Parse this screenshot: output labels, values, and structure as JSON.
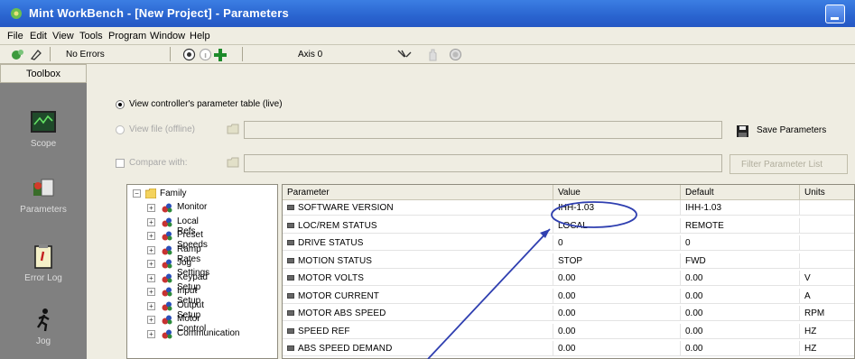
{
  "window": {
    "title": "Mint WorkBench - [New Project] - Parameters"
  },
  "menu": [
    "File",
    "Edit",
    "View",
    "Tools",
    "Program",
    "Window",
    "Help"
  ],
  "toolbar": {
    "status": "No Errors",
    "axis": "Axis 0"
  },
  "toolbox": {
    "header": "Toolbox",
    "items": [
      "Scope",
      "Parameters",
      "Error Log",
      "Jog"
    ]
  },
  "options": {
    "view_live": "View controller's parameter table (live)",
    "view_file": "View file (offline)",
    "compare_with": "Compare with:",
    "save_button": "Save Parameters",
    "filter_button": "Filter Parameter List"
  },
  "tree": {
    "root": "Family",
    "items": [
      "Monitor",
      "Local Refs",
      "Preset Speeds",
      "Ramp Rates",
      "Jog Settings",
      "Keypad Setup",
      "Input Setup",
      "Output Setup",
      "Motor Control",
      "Communication"
    ]
  },
  "grid": {
    "headers": [
      "Parameter",
      "Value",
      "Default",
      "Units"
    ],
    "rows": [
      {
        "param": "SOFTWARE VERSION",
        "value": "IHH-1.03",
        "default": "IHH-1.03",
        "units": ""
      },
      {
        "param": "LOC/REM STATUS",
        "value": "LOCAL",
        "default": "REMOTE",
        "units": ""
      },
      {
        "param": "DRIVE STATUS",
        "value": "0",
        "default": "0",
        "units": ""
      },
      {
        "param": "MOTION STATUS",
        "value": "STOP",
        "default": "FWD",
        "units": ""
      },
      {
        "param": "MOTOR VOLTS",
        "value": "0.00",
        "default": "0.00",
        "units": "V"
      },
      {
        "param": "MOTOR CURRENT",
        "value": "0.00",
        "default": "0.00",
        "units": "A"
      },
      {
        "param": "MOTOR ABS SPEED",
        "value": "0.00",
        "default": "0.00",
        "units": "RPM"
      },
      {
        "param": "SPEED REF",
        "value": "0.00",
        "default": "0.00",
        "units": "HZ"
      },
      {
        "param": "ABS SPEED DEMAND",
        "value": "0.00",
        "default": "0.00",
        "units": "HZ"
      }
    ]
  },
  "annotation_color": "#2f3fb0"
}
